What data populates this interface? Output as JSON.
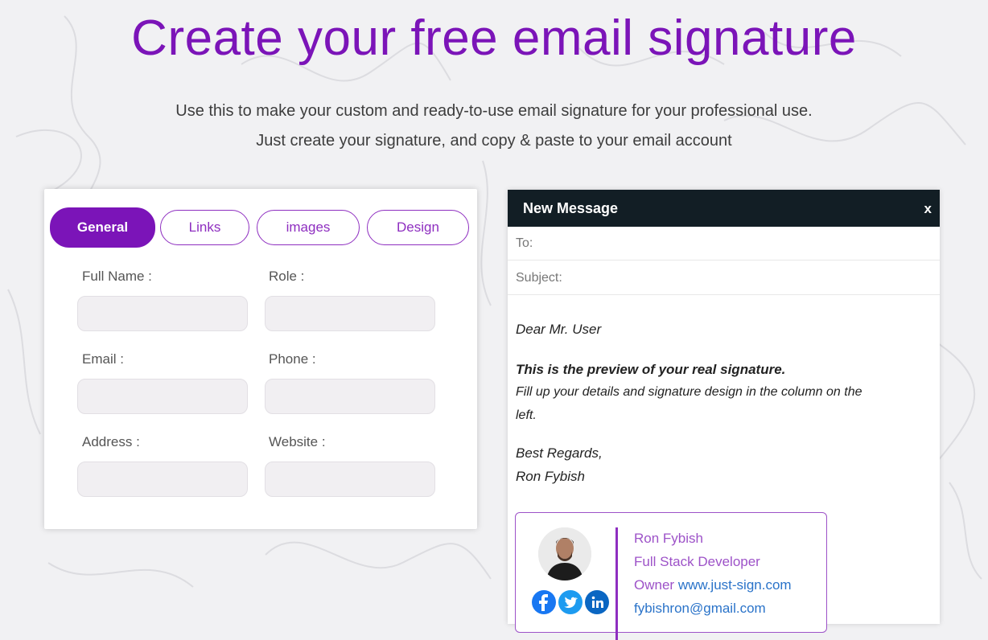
{
  "hero": {
    "title": "Create your free email signature",
    "subtitle_line1": "Use this to make your custom and ready-to-use email signature for your professional use.",
    "subtitle_line2": "Just create your signature, and copy & paste to your email account"
  },
  "form": {
    "tabs": [
      "General",
      "Links",
      "images",
      "Design"
    ],
    "active_tab": "General",
    "fields": {
      "full_name": {
        "label": "Full Name :",
        "value": ""
      },
      "role": {
        "label": "Role :",
        "value": ""
      },
      "email": {
        "label": "Email :",
        "value": ""
      },
      "phone": {
        "label": "Phone :",
        "value": ""
      },
      "address": {
        "label": "Address :",
        "value": ""
      },
      "website": {
        "label": "Website :",
        "value": ""
      }
    }
  },
  "mail": {
    "title": "New Message",
    "close": "x",
    "to_label": "To:",
    "subject_label": "Subject:",
    "greeting": "Dear Mr. User",
    "preview_bold": "This is the preview of your real signature.",
    "preview_line1": "Fill up your details and signature design in the column on the",
    "preview_line2": "left.",
    "regards": "Best Regards,",
    "sender": "Ron Fybish"
  },
  "signature": {
    "name": "Ron Fybish",
    "role": "Full Stack Developer",
    "owner_prefix": "Owner",
    "website": "www.just-sign.com",
    "email": "fybishron@gmail.com",
    "accent_color": "#8e2ec0",
    "social_icons": [
      "facebook-icon",
      "twitter-icon",
      "linkedin-icon"
    ]
  },
  "colors": {
    "brand_purple": "#7b14b8",
    "mail_header": "#121e25"
  }
}
